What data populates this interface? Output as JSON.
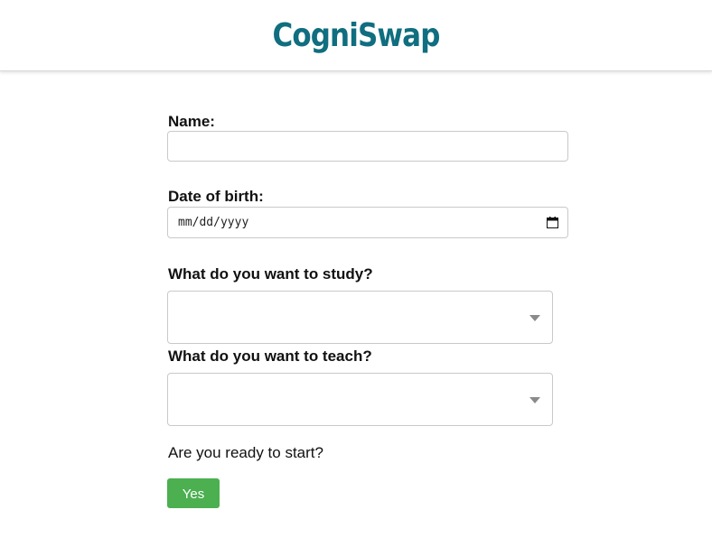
{
  "brand": {
    "name": "CogniSwap",
    "color": "#0f6e7f"
  },
  "form": {
    "name": {
      "label": "Name:",
      "value": ""
    },
    "dob": {
      "label": "Date of birth:",
      "placeholder": "mm/dd/yyyy",
      "icon": "calendar-icon"
    },
    "study": {
      "label": "What do you want to study?",
      "selected": ""
    },
    "teach": {
      "label": "What do you want to teach?",
      "selected": ""
    },
    "ready_question": "Are you ready to start?",
    "yes_button": "Yes"
  },
  "colors": {
    "button": "#4caf50",
    "input_border": "#c9c9c9"
  }
}
